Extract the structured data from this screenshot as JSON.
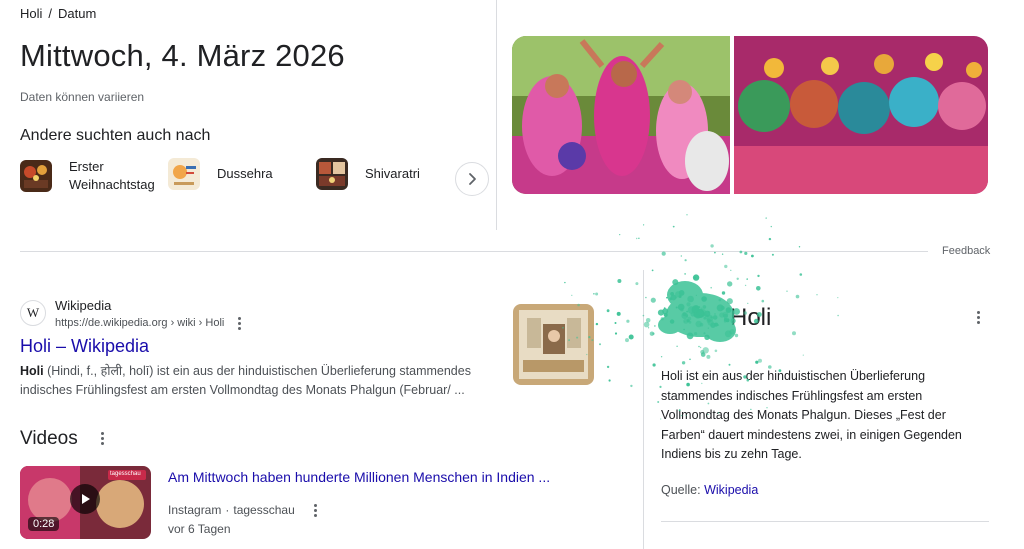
{
  "breadcrumb": {
    "items": [
      "Holi",
      "Datum"
    ],
    "separator": "/"
  },
  "headline": "Mittwoch, 4. März 2026",
  "subnote": "Daten können variieren",
  "also_searched": {
    "title": "Andere suchten auch nach",
    "chips": [
      {
        "label_line1": "Erster",
        "label_line2": "Weihnachtstag"
      },
      {
        "label_line1": "Dussehra",
        "label_line2": ""
      },
      {
        "label_line1": "Shivaratri",
        "label_line2": ""
      }
    ]
  },
  "feedback": "Feedback",
  "result": {
    "site_name": "Wikipedia",
    "favicon": "W",
    "url": "https://de.wikipedia.org › wiki › Holi",
    "title": "Holi – Wikipedia",
    "snippet_bold": "Holi",
    "snippet_line1": " (Hindi, f., होली, holī) ist ein aus der hinduistischen Überlieferung stammendes",
    "snippet_line2": "indisches Frühlingsfest am ersten Vollmondtag des Monats Phalgun (Februar/ ..."
  },
  "videos": {
    "title": "Videos",
    "items": [
      {
        "title": "Am Mittwoch haben hunderte Millionen Menschen in Indien ...",
        "platform": "Instagram",
        "separator": "·",
        "channel": "tagesschau",
        "age": "vor 6 Tagen",
        "duration": "0:28",
        "badge": "tagesschau"
      }
    ]
  },
  "knowledge_panel": {
    "title": "Holi",
    "description": "Holi ist ein aus der hinduistischen Überlieferung stammendes indisches Frühlingsfest am ersten Vollmondtag des Monats Phalgun. Dieses „Fest der Farben“ dauert mindestens zwei, in einigen Gegenden Indiens bis zu zehn Tage.",
    "source_label": "Quelle:",
    "source_link": "Wikipedia"
  },
  "colors": {
    "link": "#1a0dab",
    "text": "#202124",
    "muted": "#5f6368",
    "divider": "#dadce0",
    "splash": "#3cc296"
  },
  "icons": [
    "chevron-right-icon",
    "more-vert-icon",
    "play-icon",
    "wikipedia-favicon"
  ]
}
